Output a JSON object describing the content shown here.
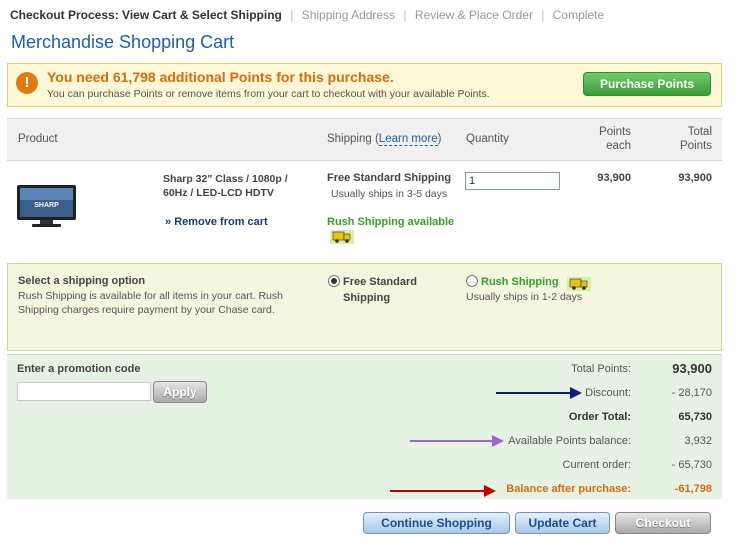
{
  "breadcrumb": {
    "label": "Checkout Process:",
    "current": "View Cart & Select Shipping",
    "steps": [
      "Shipping Address",
      "Review & Place Order",
      "Complete"
    ]
  },
  "page_title": "Merchandise Shopping Cart",
  "alert": {
    "icon": "warning-icon",
    "title": "You need 61,798 additional Points for this purchase.",
    "message": "You can purchase Points or remove items from your cart to checkout with your available Points.",
    "button": "Purchase Points"
  },
  "table": {
    "headers": {
      "product": "Product",
      "shipping": "Shipping (",
      "learn_more": "Learn more",
      "shipping_close": ")",
      "quantity": "Quantity",
      "points_each_1": "Points",
      "points_each_2": "each",
      "total_points_1": "Total",
      "total_points_2": "Points"
    },
    "item": {
      "image_brand": "SHARP",
      "name": "Sharp 32\" Class / 1080p / 60Hz / LED-LCD HDTV",
      "remove": "Remove from cart",
      "shipping_name": "Free Standard Shipping",
      "shipping_time": "Usually ships in 3-5 days",
      "rush_available": "Rush Shipping available",
      "quantity": "1",
      "points_each": "93,900",
      "total_points": "93,900"
    }
  },
  "shipping_option": {
    "title": "Select a shipping option",
    "description": "Rush Shipping is available for all items in your cart. Rush Shipping charges require payment by your Chase card.",
    "options": [
      {
        "label": "Free Standard Shipping",
        "selected": true
      },
      {
        "label": "Rush Shipping",
        "sub": "Usually ships in 1-2 days",
        "selected": false
      }
    ]
  },
  "promo": {
    "label": "Enter a promotion code",
    "value": "",
    "apply": "Apply"
  },
  "totals": [
    {
      "label": "Total Points:",
      "value": "93,900"
    },
    {
      "label": "Discount:",
      "value": "- 28,170"
    },
    {
      "label": "Order Total:",
      "value": "65,730"
    },
    {
      "label": "Available Points balance:",
      "value": "3,932"
    },
    {
      "label": "Current order:",
      "value": "- 65,730"
    },
    {
      "label": "Balance after purchase:",
      "value": "-61,798"
    }
  ],
  "colors": {
    "arrow_discount": "#0b1f7a",
    "arrow_available": "#a066cf",
    "arrow_balance": "#c00000",
    "balance_text": "#d86a10"
  },
  "buttons": {
    "continue": "Continue Shopping",
    "update": "Update Cart",
    "checkout": "Checkout"
  }
}
